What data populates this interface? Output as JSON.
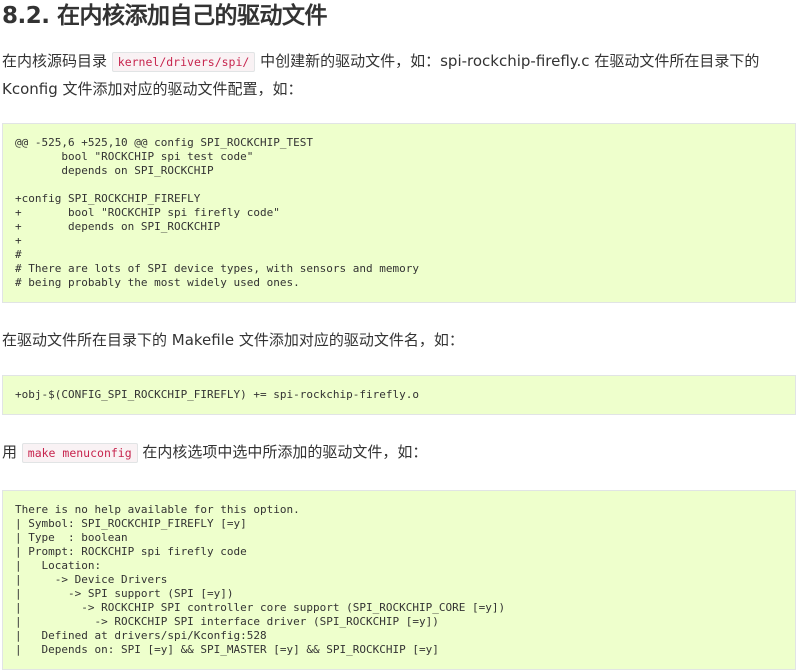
{
  "section": {
    "title": "8.2. 在内核添加自己的驱动文件"
  },
  "para1": {
    "text_before": "在内核源码目录 ",
    "code": "kernel/drivers/spi/",
    "text_after_line1": " 中创建新的驱动文件，如：spi-rockchip-firefly.c 在驱动文件所在目录下的",
    "text_line2": "Kconfig 文件添加对应的驱动文件配置，如："
  },
  "code1": {
    "content": "@@ -525,6 +525,10 @@ config SPI_ROCKCHIP_TEST\n       bool \"ROCKCHIP spi test code\"\n       depends on SPI_ROCKCHIP\n\n+config SPI_ROCKCHIP_FIREFLY\n+       bool \"ROCKCHIP spi firefly code\"\n+       depends on SPI_ROCKCHIP\n+\n#\n# There are lots of SPI device types, with sensors and memory\n# being probably the most widely used ones."
  },
  "para2": {
    "text": "在驱动文件所在目录下的 Makefile 文件添加对应的驱动文件名，如："
  },
  "code2": {
    "content": "+obj-$(CONFIG_SPI_ROCKCHIP_FIREFLY) += spi-rockchip-firefly.o"
  },
  "para3": {
    "text_before": "用 ",
    "code": "make menuconfig",
    "text_after": " 在内核选项中选中所添加的驱动文件，如："
  },
  "code3": {
    "content": "There is no help available for this option.\n| Symbol: SPI_ROCKCHIP_FIREFLY [=y]\n| Type  : boolean\n| Prompt: ROCKCHIP spi firefly code\n|   Location:\n|     -> Device Drivers\n|       -> SPI support (SPI [=y])\n|         -> ROCKCHIP SPI controller core support (SPI_ROCKCHIP_CORE [=y])\n|           -> ROCKCHIP SPI interface driver (SPI_ROCKCHIP [=y])\n|   Defined at drivers/spi/Kconfig:528\n|   Depends on: SPI [=y] && SPI_MASTER [=y] && SPI_ROCKCHIP [=y]"
  }
}
